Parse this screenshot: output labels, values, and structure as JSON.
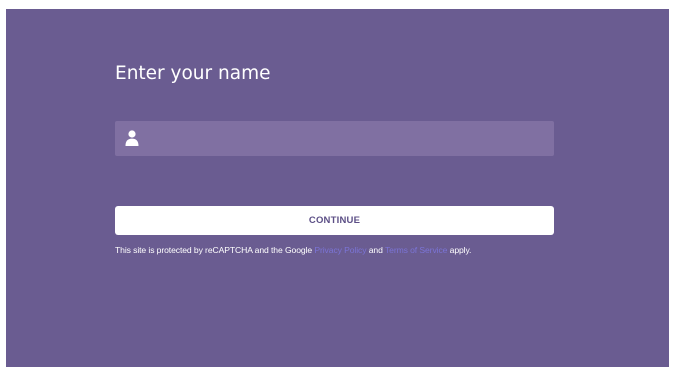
{
  "form": {
    "heading": "Enter your name",
    "name_input": {
      "value": "",
      "placeholder": "",
      "icon": "user-icon"
    },
    "continue_label": "CONTINUE"
  },
  "recaptcha": {
    "prefix": "This site is protected by reCAPTCHA and the Google",
    "privacy_link": "Privacy Policy",
    "middle": "and",
    "terms_link": "Terms of Service",
    "suffix": "apply."
  },
  "colors": {
    "background": "#6a5c91",
    "input_background": "#8070a2",
    "button_background": "#ffffff",
    "button_text": "#5c4f86",
    "link": "#7b74d6"
  }
}
